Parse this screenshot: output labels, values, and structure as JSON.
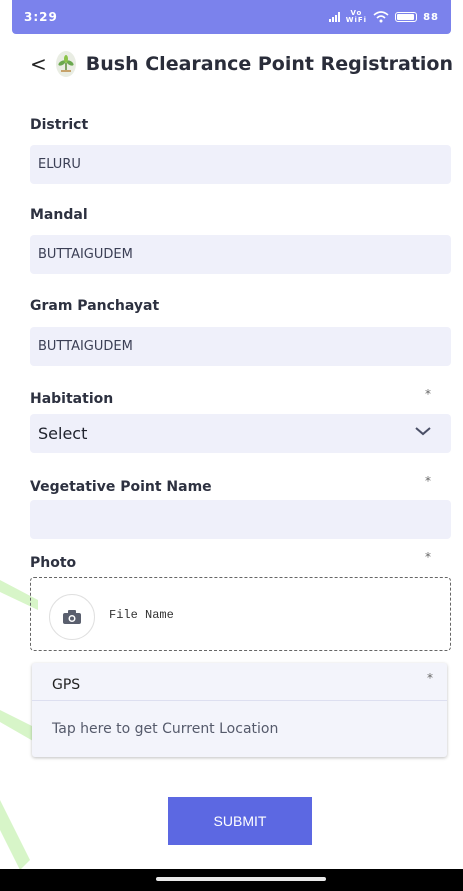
{
  "status_bar": {
    "time": "3:29",
    "vowifi_top": "Vo",
    "vowifi_bottom": "WiFi",
    "battery": "88"
  },
  "header": {
    "back_icon": "chevron-left",
    "back_glyph": "<",
    "logo_icon": "plant-logo",
    "title": "Bush Clearance Point Registration"
  },
  "form": {
    "district": {
      "label": "District",
      "value": "ELURU"
    },
    "mandal": {
      "label": "Mandal",
      "value": "BUTTAIGUDEM"
    },
    "gram_panchayat": {
      "label": "Gram Panchayat",
      "value": "BUTTAIGUDEM"
    },
    "habitation": {
      "label": "Habitation",
      "value": "Select",
      "required": "*"
    },
    "vegetative_point": {
      "label": "Vegetative Point Name",
      "value": "",
      "required": "*"
    },
    "photo": {
      "label": "Photo",
      "file_name": "File Name",
      "required": "*",
      "icon": "camera-icon"
    },
    "gps": {
      "title": "GPS",
      "tap_text": "Tap here to get Current Location",
      "required": "*"
    },
    "submit_label": "SUBMIT"
  },
  "colors": {
    "accent": "#5c68e2",
    "status_bar": "#7b82ec",
    "field_bg": "#eff0fa"
  }
}
